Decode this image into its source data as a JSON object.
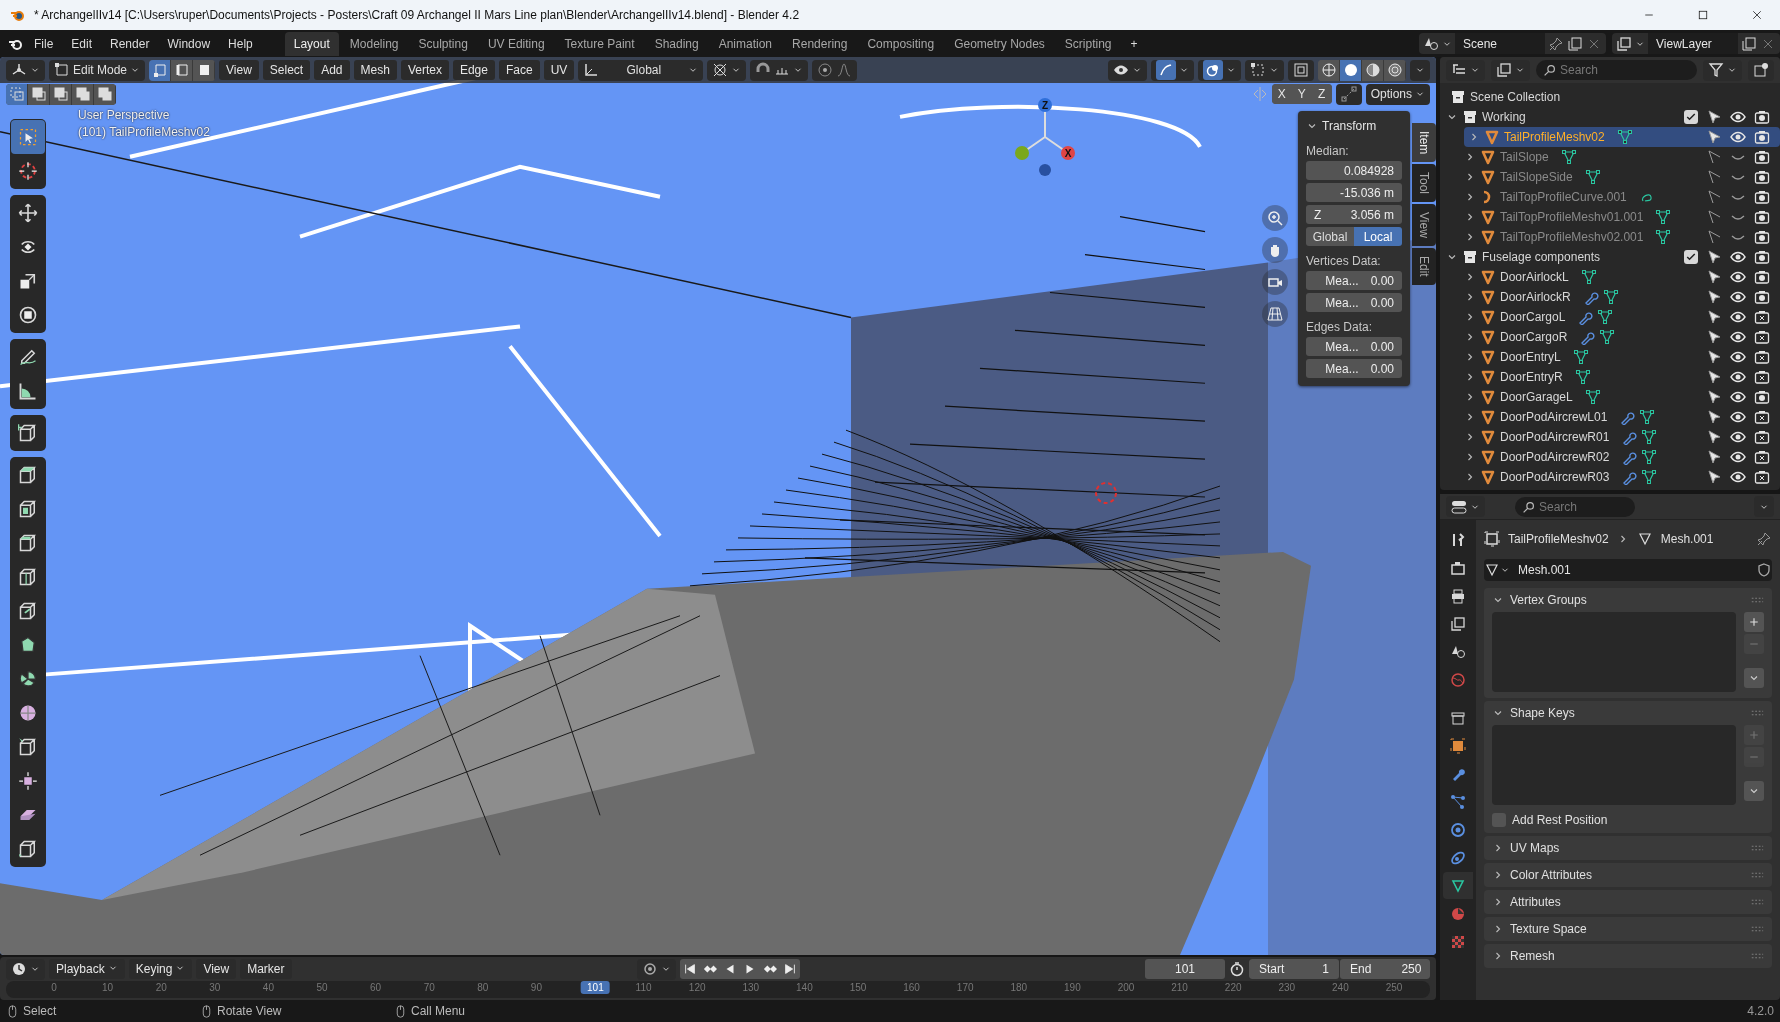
{
  "window": {
    "title": "* ArchangelIIv14 [C:\\Users\\ruper\\Documents\\Projects - Posters\\Craft 09 Archangel II Mars Line plan\\Blender\\ArchangelIIv14.blend] - Blender 4.2"
  },
  "menu": [
    "File",
    "Edit",
    "Render",
    "Window",
    "Help"
  ],
  "workspaces": [
    {
      "label": "Layout",
      "selected": true
    },
    {
      "label": "Modeling",
      "selected": false
    },
    {
      "label": "Sculpting",
      "selected": false
    },
    {
      "label": "UV Editing",
      "selected": false
    },
    {
      "label": "Texture Paint",
      "selected": false
    },
    {
      "label": "Shading",
      "selected": false
    },
    {
      "label": "Animation",
      "selected": false
    },
    {
      "label": "Rendering",
      "selected": false
    },
    {
      "label": "Compositing",
      "selected": false
    },
    {
      "label": "Geometry Nodes",
      "selected": false
    },
    {
      "label": "Scripting",
      "selected": false
    }
  ],
  "add_workspace": "+",
  "scene": {
    "name": "Scene"
  },
  "view_layer": {
    "name": "ViewLayer"
  },
  "viewport": {
    "mode": "Edit Mode",
    "select_modes": [
      {
        "selected": true
      },
      {
        "selected": false
      },
      {
        "selected": false
      }
    ],
    "menus": [
      "View",
      "Select",
      "Add",
      "Mesh",
      "Vertex",
      "Edge",
      "Face",
      "UV"
    ],
    "orientation": "Global",
    "shading": [
      {
        "selected": false
      },
      {
        "selected": true
      },
      {
        "selected": false
      },
      {
        "selected": false
      }
    ],
    "axis_toggles": [
      {
        "label": "X",
        "on": false
      },
      {
        "label": "Y",
        "on": false
      },
      {
        "label": "Z",
        "on": false
      }
    ],
    "options": "Options",
    "overlay_lines": [
      "User Perspective",
      "(101) TailProfileMeshv02"
    ],
    "gizmo_axes": [
      "Z",
      "X"
    ],
    "gizmos": {
      "on": true
    },
    "overlays": {
      "on": true
    }
  },
  "toolbar": [
    [
      {
        "selected": true
      },
      {
        "selected": false
      }
    ],
    [
      {
        "selected": false
      },
      {
        "selected": false
      },
      {
        "selected": false
      },
      {
        "selected": false
      }
    ],
    [
      {
        "selected": false
      },
      {
        "selected": false
      }
    ],
    [
      {
        "selected": false
      }
    ],
    [
      {
        "selected": false
      },
      {
        "selected": false
      },
      {
        "selected": false
      },
      {
        "selected": false
      },
      {
        "selected": false
      },
      {
        "selected": false
      },
      {
        "selected": false
      },
      {
        "selected": false
      },
      {
        "selected": false
      },
      {
        "selected": false
      },
      {
        "selected": false
      },
      {
        "selected": false
      }
    ]
  ],
  "sidebar": {
    "tabs": [
      {
        "label": "Item",
        "selected": true
      },
      {
        "label": "Tool",
        "selected": false
      },
      {
        "label": "View",
        "selected": false
      },
      {
        "label": "Edit",
        "selected": false
      }
    ],
    "panel": {
      "title": "Transform",
      "expanded": true,
      "median_label": "Median:",
      "fields": [
        {
          "value": "0.084928"
        },
        {
          "value": "-15.036 m"
        },
        {
          "label": "Z",
          "value": "3.056 m"
        }
      ],
      "space": [
        {
          "label": "Global",
          "selected": false
        },
        {
          "label": "Local",
          "selected": true
        }
      ],
      "sections": [
        {
          "title": "Vertices Data:",
          "rows": [
            {
              "label": "Mea...",
              "value": "0.00"
            },
            {
              "label": "Mea...",
              "value": "0.00"
            }
          ]
        },
        {
          "title": "Edges Data:",
          "rows": [
            {
              "label": "Mea...",
              "value": "0.00"
            },
            {
              "label": "Mea...",
              "value": "0.00"
            }
          ]
        }
      ]
    }
  },
  "outliner": {
    "search": {
      "placeholder": "Search"
    },
    "tree": {
      "label": "Scene Collection",
      "children": [
        {
          "label": "Working",
          "kind": "collection",
          "expanded": true,
          "checked": true,
          "children": [
            {
              "label": "TailProfileMeshv02",
              "kind": "mesh",
              "modifier": false,
              "visible": true,
              "render": true,
              "selected": true
            },
            {
              "label": "TailSlope",
              "kind": "mesh",
              "modifier": false,
              "visible": false,
              "render": true,
              "selected": false
            },
            {
              "label": "TailSlopeSide",
              "kind": "mesh",
              "modifier": false,
              "visible": false,
              "render": true,
              "selected": false
            },
            {
              "label": "TailTopProfileCurve.001",
              "kind": "curve",
              "modifier": false,
              "visible": false,
              "render": true,
              "selected": false
            },
            {
              "label": "TailTopProfileMeshv01.001",
              "kind": "mesh",
              "modifier": false,
              "visible": false,
              "render": true,
              "selected": false
            },
            {
              "label": "TailTopProfileMeshv02.001",
              "kind": "mesh",
              "modifier": false,
              "visible": false,
              "render": true,
              "selected": false
            }
          ]
        },
        {
          "label": "Fuselage components",
          "kind": "collection",
          "expanded": true,
          "checked": true,
          "children": [
            {
              "label": "DoorAirlockL",
              "kind": "mesh",
              "modifier": false,
              "visible": true,
              "render": true,
              "selected": false
            },
            {
              "label": "DoorAirlockR",
              "kind": "mesh",
              "modifier": true,
              "visible": true,
              "render": true,
              "selected": false
            },
            {
              "label": "DoorCargoL",
              "kind": "mesh",
              "modifier": true,
              "visible": true,
              "render": false,
              "selected": false
            },
            {
              "label": "DoorCargoR",
              "kind": "mesh",
              "modifier": true,
              "visible": true,
              "render": false,
              "selected": false
            },
            {
              "label": "DoorEntryL",
              "kind": "mesh",
              "modifier": false,
              "visible": true,
              "render": false,
              "selected": false
            },
            {
              "label": "DoorEntryR",
              "kind": "mesh",
              "modifier": false,
              "visible": true,
              "render": false,
              "selected": false
            },
            {
              "label": "DoorGarageL",
              "kind": "mesh",
              "modifier": false,
              "visible": true,
              "render": true,
              "selected": false
            },
            {
              "label": "DoorPodAircrewL01",
              "kind": "mesh",
              "modifier": true,
              "visible": true,
              "render": false,
              "selected": false
            },
            {
              "label": "DoorPodAircrewR01",
              "kind": "mesh",
              "modifier": true,
              "visible": true,
              "render": false,
              "selected": false
            },
            {
              "label": "DoorPodAircrewR02",
              "kind": "mesh",
              "modifier": true,
              "visible": true,
              "render": false,
              "selected": false
            },
            {
              "label": "DoorPodAircrewR03",
              "kind": "mesh",
              "modifier": true,
              "visible": true,
              "render": false,
              "selected": false
            }
          ]
        }
      ]
    }
  },
  "properties": {
    "search": {
      "placeholder": "Search"
    },
    "tabs": [
      {
        "selected": false
      },
      {
        "selected": false
      },
      {
        "selected": false
      },
      {
        "selected": false
      },
      {
        "selected": false
      },
      {
        "selected": false
      },
      {
        "selected": false
      },
      {
        "selected": false
      },
      {
        "selected": false
      },
      {
        "selected": false
      },
      {
        "selected": false
      },
      {
        "selected": false
      },
      {
        "selected": true
      },
      {
        "selected": false
      },
      {
        "selected": false
      }
    ],
    "breadcrumb": {
      "object": "TailProfileMeshv02",
      "data": "Mesh.001"
    },
    "datablock": "Mesh.001",
    "panels": [
      {
        "title": "Vertex Groups",
        "kind": "list",
        "expanded": true,
        "add_disabled": false,
        "remove_disabled": true
      },
      {
        "title": "Shape Keys",
        "kind": "list",
        "expanded": true,
        "add_disabled": true,
        "remove_disabled": true,
        "checkbox": {
          "label": "Add Rest Position",
          "checked": false
        }
      },
      {
        "title": "UV Maps",
        "kind": "plain",
        "expanded": false
      },
      {
        "title": "Color Attributes",
        "kind": "plain",
        "expanded": false
      },
      {
        "title": "Attributes",
        "kind": "plain",
        "expanded": false
      },
      {
        "title": "Texture Space",
        "kind": "plain",
        "expanded": false
      },
      {
        "title": "Remesh",
        "kind": "plain",
        "expanded": false
      }
    ]
  },
  "timeline": {
    "menus": [
      {
        "label": "Playback",
        "dropdown": true
      },
      {
        "label": "Keying",
        "dropdown": true
      },
      {
        "label": "View",
        "dropdown": false
      },
      {
        "label": "Marker",
        "dropdown": false
      }
    ],
    "current_frame": "101",
    "start": {
      "label": "Start",
      "value": "1"
    },
    "end": {
      "label": "End",
      "value": "250"
    },
    "ruler": [
      "0",
      "10",
      "20",
      "30",
      "40",
      "50",
      "60",
      "70",
      "80",
      "90",
      "110",
      "120",
      "130",
      "140",
      "150",
      "160",
      "170",
      "180",
      "190",
      "200",
      "210",
      "220",
      "230",
      "240",
      "250"
    ],
    "marker": "101"
  },
  "status_bar": {
    "hints": [
      "Select",
      "Rotate View",
      "Call Menu"
    ],
    "version": "4.2.0"
  }
}
